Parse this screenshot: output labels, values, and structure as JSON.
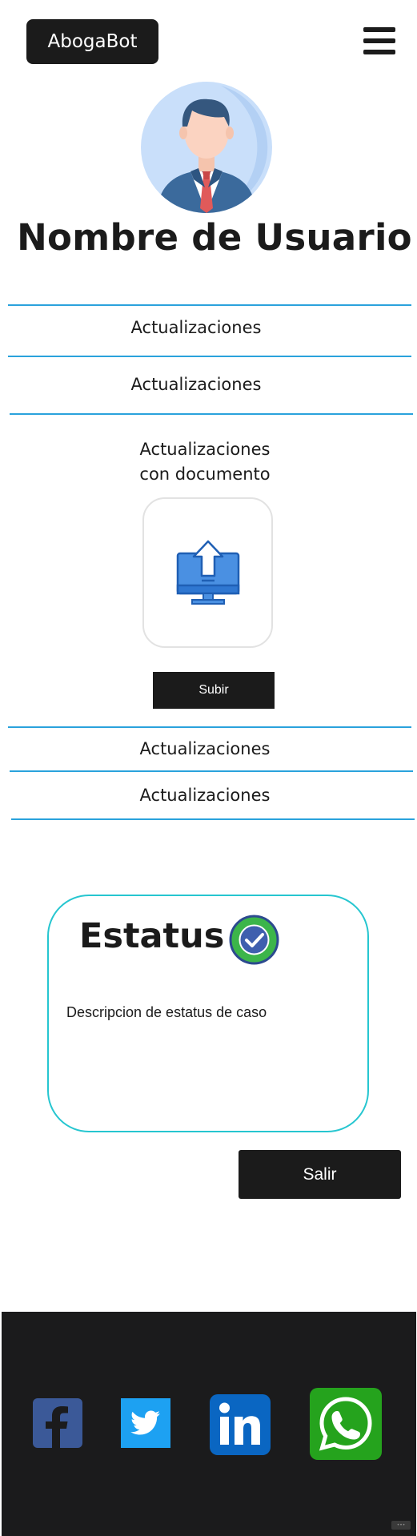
{
  "header": {
    "logo_label": "AbogaBot",
    "menu_icon": "hamburger-menu-icon"
  },
  "profile": {
    "avatar_icon": "user-avatar-icon",
    "user_name": "Nombre de Usuario"
  },
  "updates": {
    "item_1": "Actualizaciones",
    "item_2": "Actualizaciones",
    "doc_line_1": "Actualizaciones",
    "doc_line_2": "con documento",
    "upload_icon": "computer-upload-icon",
    "upload_button": "Subir",
    "item_3": "Actualizaciones",
    "item_4": "Actualizaciones"
  },
  "status": {
    "title": "Estatus",
    "check_icon": "check-circle-icon",
    "description": "Descripcion de estatus de caso"
  },
  "actions": {
    "exit_button": "Salir"
  },
  "footer": {
    "social_icons": [
      "facebook-icon",
      "twitter-icon",
      "linkedin-icon",
      "whatsapp-icon"
    ]
  },
  "colors": {
    "accent_line": "#2aa2dc",
    "status_border": "#26c6d0",
    "dark": "#1b1b1b",
    "check_green": "#3cb54a",
    "facebook": "#3b5998",
    "twitter": "#1da1f2",
    "linkedin": "#0a66c2",
    "whatsapp": "#25a31d"
  }
}
